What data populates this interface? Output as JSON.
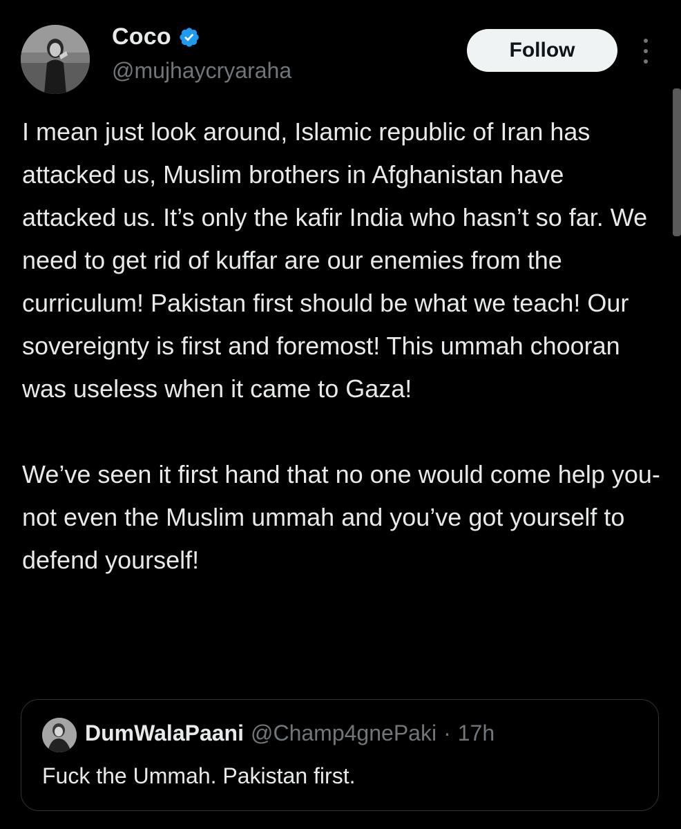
{
  "author": {
    "display_name": "Coco",
    "handle": "@mujhaycryaraha",
    "verified": true,
    "avatar_icon": "profile-photo"
  },
  "actions": {
    "follow_label": "Follow",
    "more_icon": "more-vertical-icon"
  },
  "tweet": {
    "paragraphs": [
      "I mean just look around, Islamic republic of Iran has attacked us, Muslim brothers in Afghanistan have attacked us. It’s only the kafir India who hasn’t so far. We need to get rid of kuffar are our enemies from the curriculum! Pakistan first should be what we teach! Our sovereignty is first and foremost! This ummah chooran was useless when it came to Gaza!",
      "We’ve seen it first hand that no one would come help you- not even the Muslim ummah and you’ve got yourself to defend yourself!"
    ]
  },
  "quoted_tweet": {
    "display_name": "DumWalaPaani",
    "handle": "@Champ4gnePaki",
    "separator": "·",
    "time": "17h",
    "text": "Fuck the Ummah. Pakistan first."
  },
  "colors": {
    "background": "#000000",
    "text_primary": "#e7e9ea",
    "text_secondary": "#71767b",
    "verified_blue": "#1d9bf0",
    "follow_button_bg": "#eff3f4",
    "border": "#2f3336"
  }
}
